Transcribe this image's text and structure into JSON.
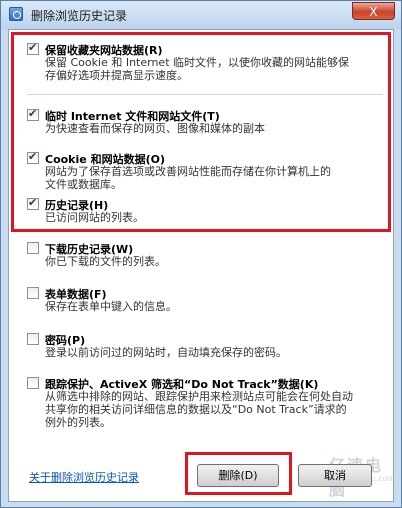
{
  "window": {
    "title": "删除浏览历史记录",
    "close_label": "X"
  },
  "items": [
    {
      "label": "保留收藏夹网站数据(R)",
      "desc": "保留 Cookie 和 Internet 临时文件，以使你收藏的网站能够保\n存偏好选项并提高显示速度。",
      "checked": true
    },
    {
      "label": "临时 Internet 文件和网站文件(T)",
      "desc": "为快速查看而保存的网页、图像和媒体的副本",
      "checked": true
    },
    {
      "label": "Cookie 和网站数据(O)",
      "desc": "网站为了保存首选项或改善网站性能而存储在你计算机上的\n文件或数据库。",
      "checked": true
    },
    {
      "label": "历史记录(H)",
      "desc": "已访问网站的列表。",
      "checked": true
    },
    {
      "label": "下载历史记录(W)",
      "desc": "你已下载的文件的列表。",
      "checked": false
    },
    {
      "label": "表单数据(F)",
      "desc": "保存在表单中键入的信息。",
      "checked": false
    },
    {
      "label": "密码(P)",
      "desc": "登录以前访问过的网站时，自动填充保存的密码。",
      "checked": false
    },
    {
      "label": "跟踪保护、ActiveX 筛选和“Do Not Track”数据(K)",
      "desc": "从筛选中排除的网站、跟踪保护用来检测站点可能会在何处自动\n共享你的相关访问详细信息的数据以及“Do Not Track”请求的\n例外的列表。",
      "checked": false
    }
  ],
  "footer": {
    "link": "关于删除浏览历史记录",
    "delete_label": "删除(D)",
    "cancel_label": "取消"
  },
  "watermark": {
    "text": "亿速电脑",
    "url": "www.yiisu.com"
  }
}
